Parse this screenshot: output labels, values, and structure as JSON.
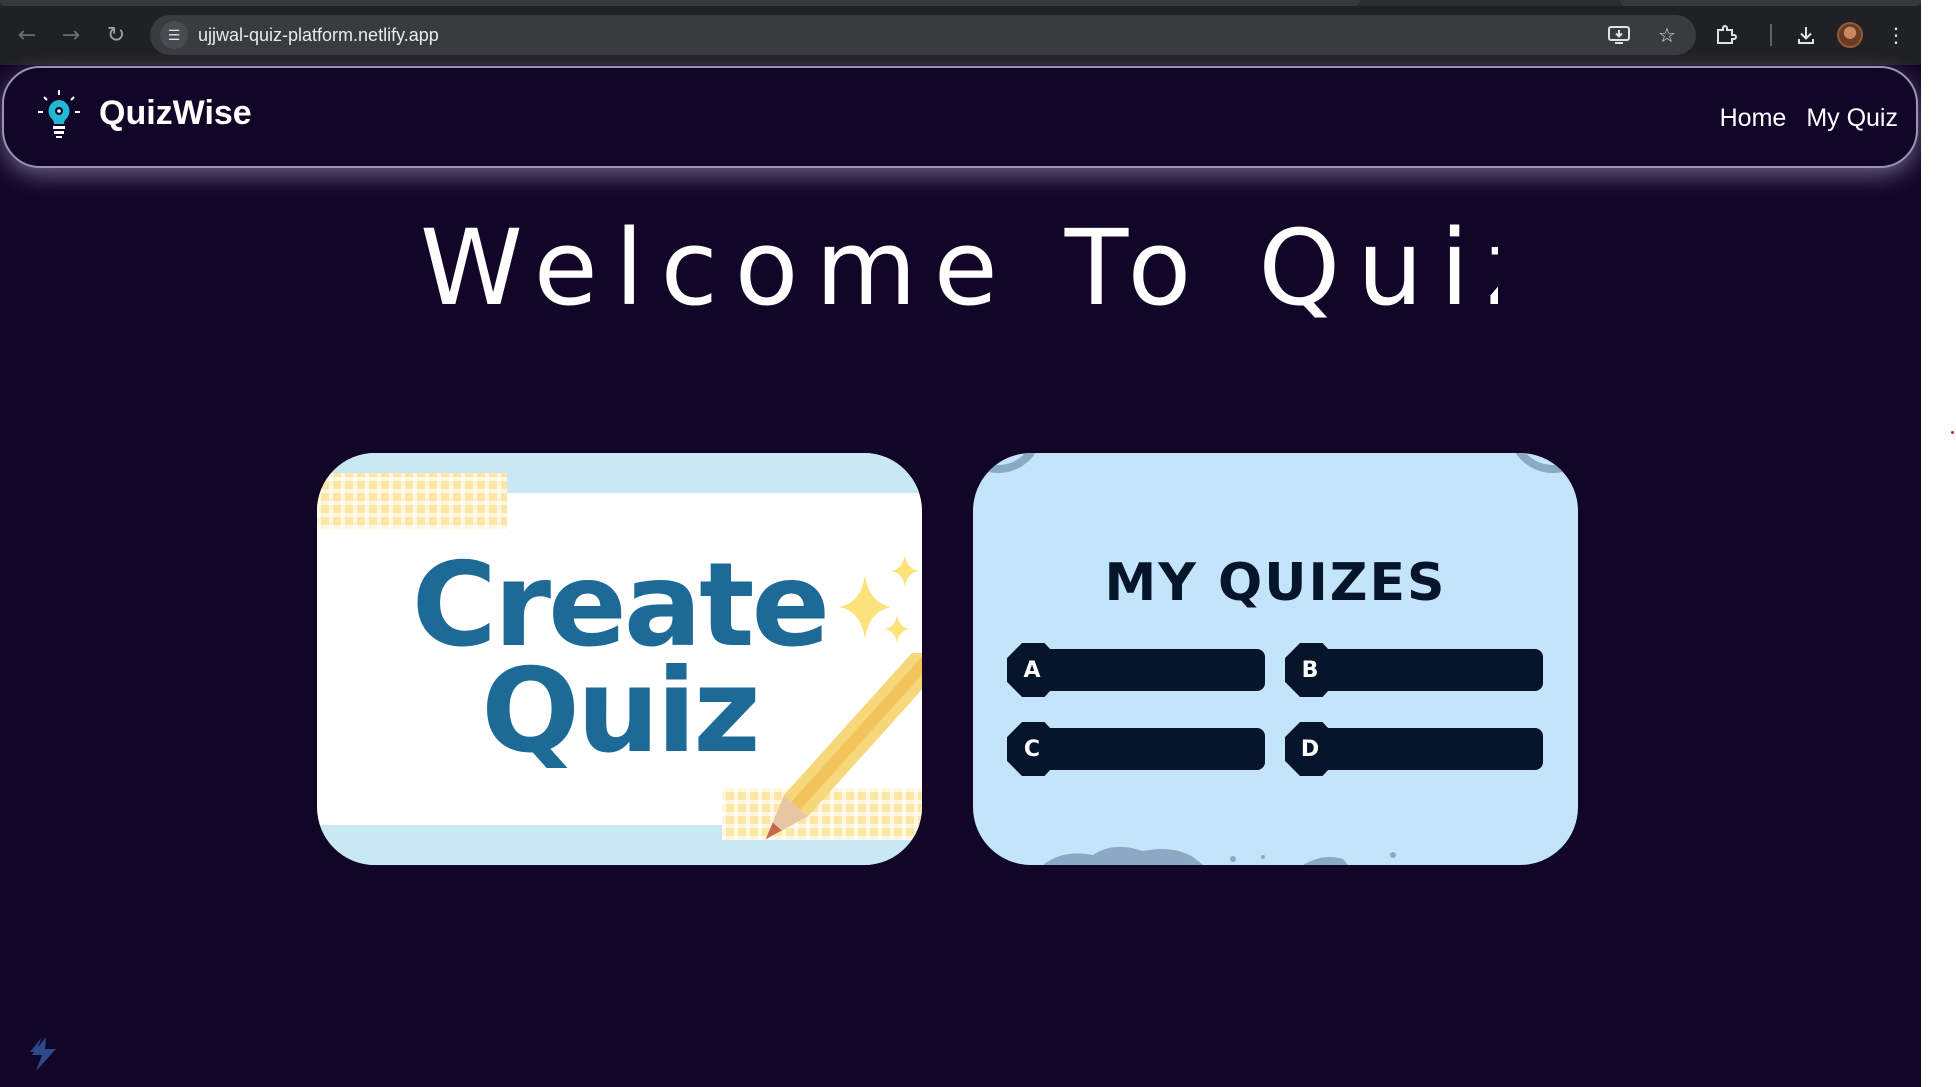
{
  "browser": {
    "url": "ujjwal-quiz-platform.netlify.app",
    "back_icon": "arrow-left-icon",
    "forward_icon": "arrow-right-icon",
    "reload_icon": "reload-icon",
    "site_info_icon": "tune-icon",
    "install_icon": "install-app-icon",
    "bookmark_icon": "star-icon",
    "extensions_icon": "puzzle-icon",
    "downloads_icon": "download-icon",
    "menu_icon": "more-vertical-icon"
  },
  "navbar": {
    "brand": "QuizWise",
    "links": [
      "Home",
      "My Quiz"
    ]
  },
  "hero": {
    "heading": "Welcome To QuizW"
  },
  "cards": {
    "create": {
      "line1": "Create",
      "line2": "Quiz"
    },
    "my_quizzes": {
      "title": "MY QUIZES",
      "options": [
        "A",
        "B",
        "C",
        "D"
      ]
    }
  },
  "colors": {
    "page_bg": "#120628",
    "create_text": "#1d6a97",
    "myquiz_bg": "#c4e4fb",
    "option_dark": "#061529"
  }
}
